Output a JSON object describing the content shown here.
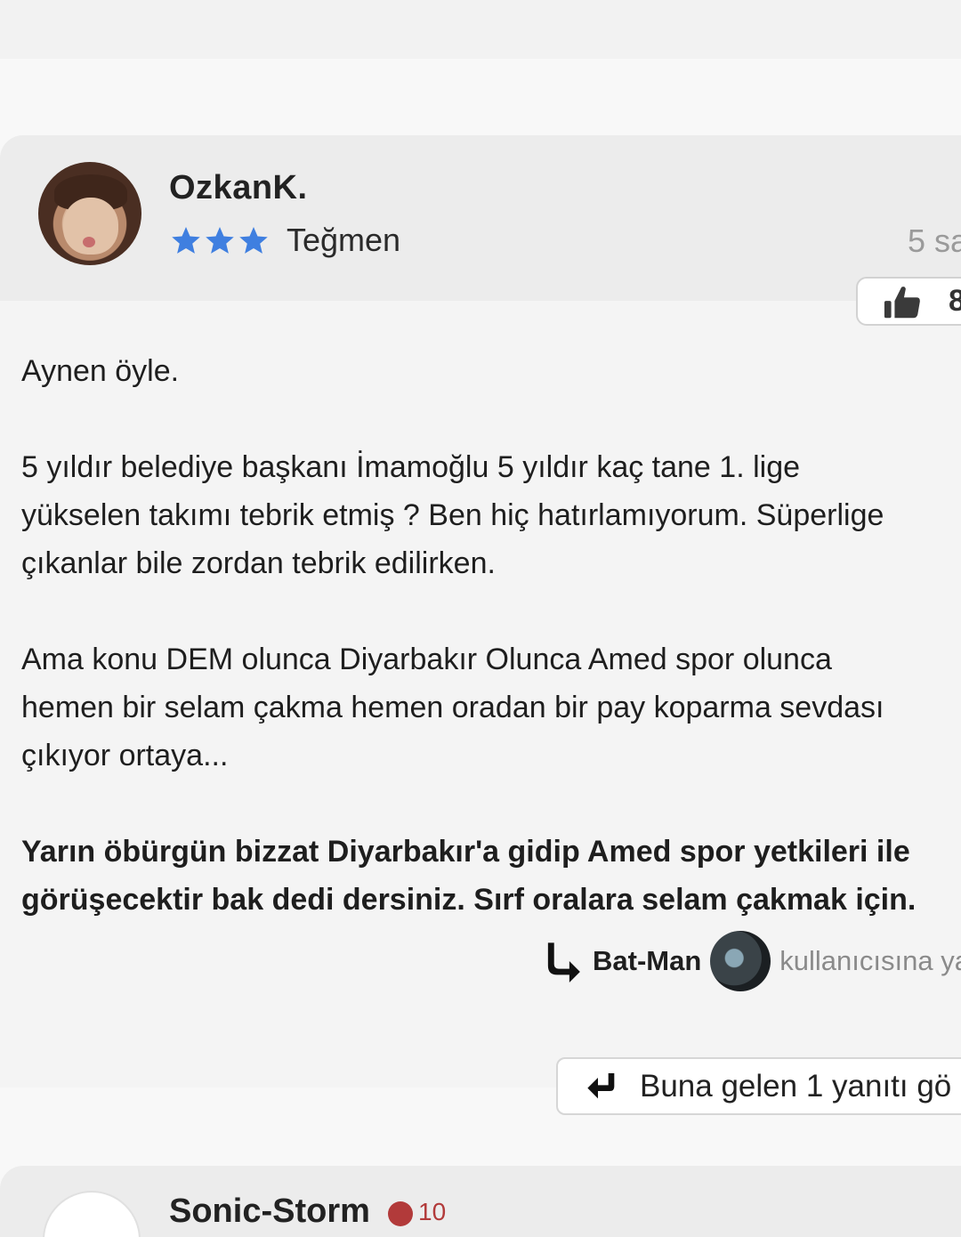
{
  "comment": {
    "username": "OzkanK.",
    "rank": {
      "stars": 3,
      "label": "Teğmen"
    },
    "timestamp": "5 sa",
    "likes": "8",
    "body_paragraphs": [
      {
        "lines": [
          "Aynen öyle."
        ]
      },
      {
        "lines": [
          "5 yıldır belediye başkanı İmamoğlu 5 yıldır kaç tane 1. lige",
          "yükselen takımı tebrik etmiş ? Ben hiç hatırlamıyorum. Süperlige",
          "çıkanlar bile zordan tebrik edilirken."
        ]
      },
      {
        "lines": [
          "Ama konu DEM olunca Diyarbakır Olunca Amed spor olunca",
          "hemen bir selam çakma hemen oradan bir pay koparma sevdası",
          "çıkıyor ortaya..."
        ]
      },
      {
        "lines": [
          "Yarın öbürgün bizzat Diyarbakır'a gidip Amed spor yetkileri ile",
          "görüşecektir bak dedi dersiniz. Sırf oralara selam çakmak için."
        ],
        "bold": true
      }
    ],
    "reply_to": {
      "username": "Bat-Man",
      "suffix": "kullanıcısına ya"
    },
    "replies_button": "Buna gelen 1 yanıtı gö"
  },
  "next_comment": {
    "username": "Sonic-Storm",
    "badge_count": "10"
  },
  "colors": {
    "star": "#3f7fe0",
    "header_bg": "#ececec",
    "card_bg": "#f4f4f4",
    "timestamp": "#9a9a9a"
  }
}
